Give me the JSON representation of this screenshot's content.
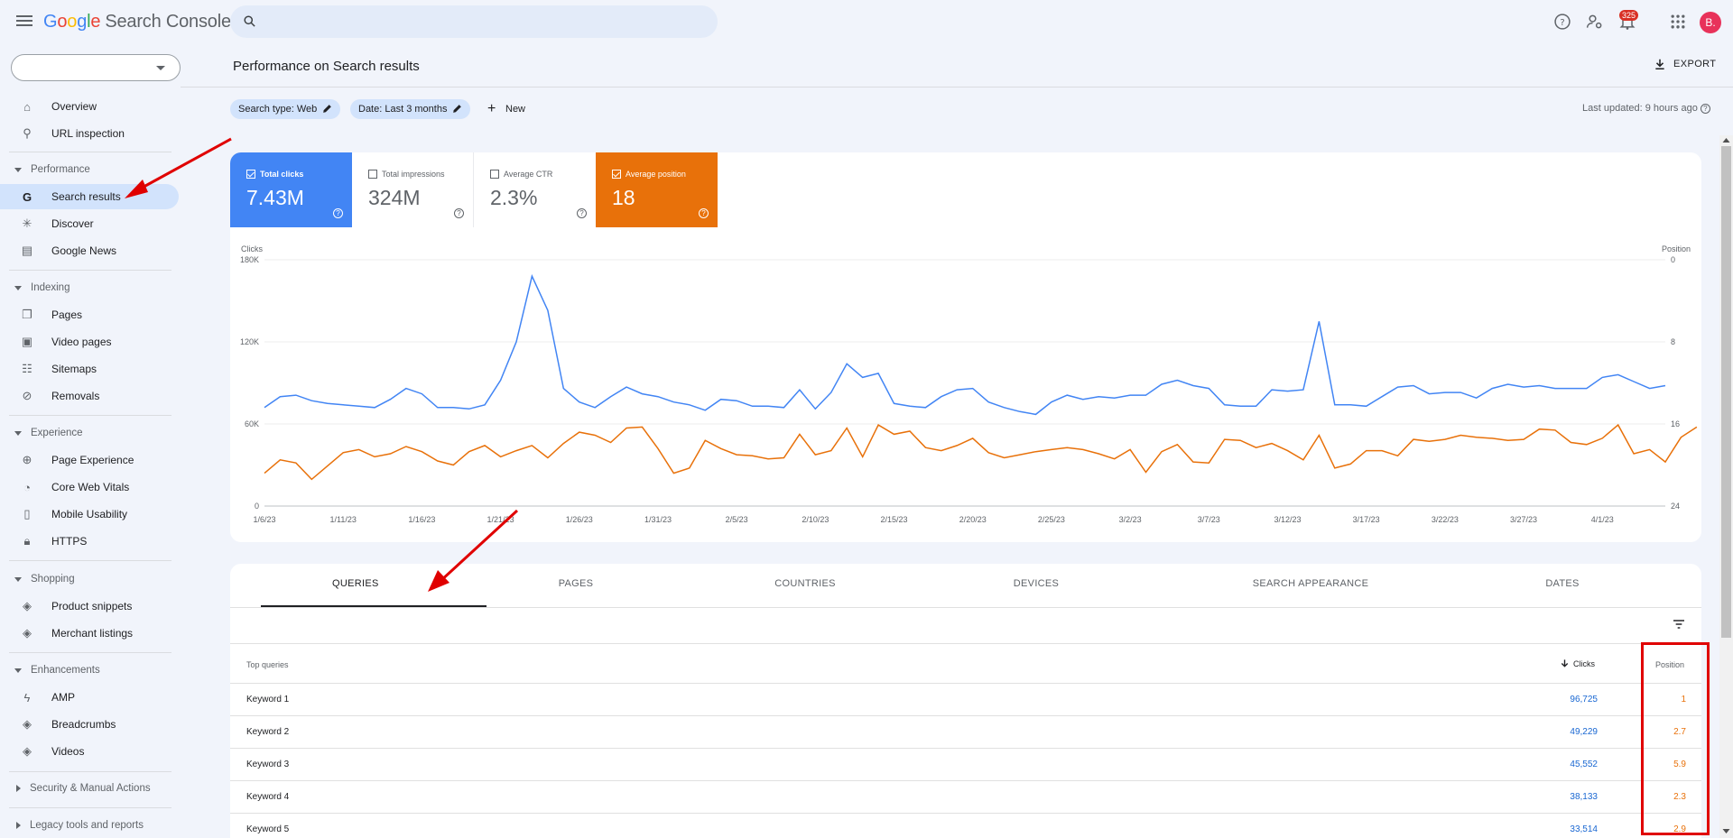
{
  "app": {
    "logo_word": "Google",
    "product": "Search Console",
    "notification_count": "325",
    "avatar_letter": "B."
  },
  "sidebar": {
    "items": [
      {
        "label": "Overview",
        "icon": "home-icon"
      },
      {
        "label": "URL inspection",
        "icon": "search-icon"
      }
    ],
    "sections": {
      "performance": {
        "title": "Performance",
        "items": [
          "Search results",
          "Discover",
          "Google News"
        ]
      },
      "indexing": {
        "title": "Indexing",
        "items": [
          "Pages",
          "Video pages",
          "Sitemaps",
          "Removals"
        ]
      },
      "experience": {
        "title": "Experience",
        "items": [
          "Page Experience",
          "Core Web Vitals",
          "Mobile Usability",
          "HTTPS"
        ]
      },
      "shopping": {
        "title": "Shopping",
        "items": [
          "Product snippets",
          "Merchant listings"
        ]
      },
      "enhancements": {
        "title": "Enhancements",
        "items": [
          "AMP",
          "Breadcrumbs",
          "Videos"
        ]
      },
      "security": {
        "title": "Security & Manual Actions"
      },
      "legacy": {
        "title": "Legacy tools and reports"
      }
    }
  },
  "header": {
    "title": "Performance on Search results",
    "export_label": "EXPORT",
    "filters": {
      "search_type": "Search type: Web",
      "date": "Date: Last 3 months",
      "new_label": "New"
    },
    "last_updated": "Last updated: 9 hours ago"
  },
  "metrics": {
    "clicks": {
      "label": "Total clicks",
      "value": "7.43M"
    },
    "impressions": {
      "label": "Total impressions",
      "value": "324M"
    },
    "ctr": {
      "label": "Average CTR",
      "value": "2.3%"
    },
    "position": {
      "label": "Average position",
      "value": "18"
    }
  },
  "chart_data": {
    "type": "line",
    "left_axis_label": "Clicks",
    "right_axis_label": "Position",
    "left_ticks": [
      "180K",
      "120K",
      "60K",
      "0"
    ],
    "right_ticks": [
      "0",
      "8",
      "16",
      "24"
    ],
    "ylim_left": [
      0,
      180000
    ],
    "ylim_right": [
      0,
      24
    ],
    "x_ticks": [
      "1/6/23",
      "1/11/23",
      "1/16/23",
      "1/21/23",
      "1/26/23",
      "1/31/23",
      "2/5/23",
      "2/10/23",
      "2/15/23",
      "2/20/23",
      "2/25/23",
      "3/2/23",
      "3/7/23",
      "3/12/23",
      "3/17/23",
      "3/22/23",
      "3/27/23",
      "4/1/23"
    ],
    "series": [
      {
        "name": "Clicks",
        "color": "#4285f4",
        "axis": "left",
        "values": [
          72000,
          80000,
          81000,
          77000,
          75000,
          74000,
          73000,
          72000,
          78000,
          86000,
          82000,
          72000,
          72000,
          71000,
          74000,
          92000,
          120000,
          168000,
          143000,
          86000,
          76000,
          72000,
          80000,
          87000,
          82000,
          80000,
          76000,
          74000,
          70000,
          78000,
          77000,
          73000,
          73000,
          72000,
          85000,
          71000,
          83000,
          104000,
          94000,
          97000,
          75000,
          73000,
          72000,
          80000,
          85000,
          86000,
          76000,
          72000,
          69000,
          67000,
          76000,
          81000,
          78000,
          80000,
          79000,
          81000,
          81000,
          89000,
          92000,
          88000,
          86000,
          74000,
          73000,
          73000,
          85000,
          84000,
          85000,
          135000,
          74000,
          74000,
          73000,
          80000,
          87000,
          88000,
          82000,
          83000,
          83000,
          79000,
          86000,
          89000,
          87000,
          88000,
          86000,
          86000,
          86000,
          94000,
          96000,
          91000,
          86000,
          88000
        ]
      },
      {
        "name": "Position",
        "color": "#e8710a",
        "axis": "right",
        "values": [
          20.8,
          19.5,
          19.8,
          21.4,
          20.1,
          18.8,
          18.5,
          19.2,
          18.9,
          18.2,
          18.7,
          19.6,
          20.0,
          18.7,
          18.1,
          19.2,
          18.6,
          18.1,
          19.3,
          17.9,
          16.8,
          17.1,
          17.8,
          16.4,
          16.3,
          18.4,
          20.8,
          20.3,
          17.6,
          18.4,
          19.0,
          19.1,
          19.4,
          19.3,
          17.0,
          19.0,
          18.6,
          16.4,
          19.2,
          16.1,
          17.0,
          16.7,
          18.3,
          18.6,
          18.1,
          17.4,
          18.8,
          19.3,
          19.0,
          18.7,
          18.5,
          18.3,
          18.5,
          18.9,
          19.4,
          18.5,
          20.7,
          18.7,
          18.0,
          19.7,
          19.8,
          17.5,
          17.6,
          18.3,
          17.9,
          18.6,
          19.5,
          17.1,
          20.3,
          19.9,
          18.6,
          18.6,
          19.1,
          17.5,
          17.7,
          17.5,
          17.1,
          17.3,
          17.4,
          17.6,
          17.5,
          16.5,
          16.6,
          17.8,
          18.0,
          17.4,
          16.1,
          18.9,
          18.5,
          19.7,
          17.3,
          16.3
        ]
      }
    ]
  },
  "table": {
    "tabs": [
      "QUERIES",
      "PAGES",
      "COUNTRIES",
      "DEVICES",
      "SEARCH APPEARANCE",
      "DATES"
    ],
    "headers": {
      "query": "Top queries",
      "clicks": "Clicks",
      "position": "Position"
    },
    "rows": [
      {
        "query": "Keyword 1",
        "clicks": "96,725",
        "position": "1"
      },
      {
        "query": "Keyword 2",
        "clicks": "49,229",
        "position": "2.7"
      },
      {
        "query": "Keyword 3",
        "clicks": "45,552",
        "position": "5.9"
      },
      {
        "query": "Keyword 4",
        "clicks": "38,133",
        "position": "2.3"
      },
      {
        "query": "Keyword 5",
        "clicks": "33,514",
        "position": "2.9"
      }
    ]
  }
}
